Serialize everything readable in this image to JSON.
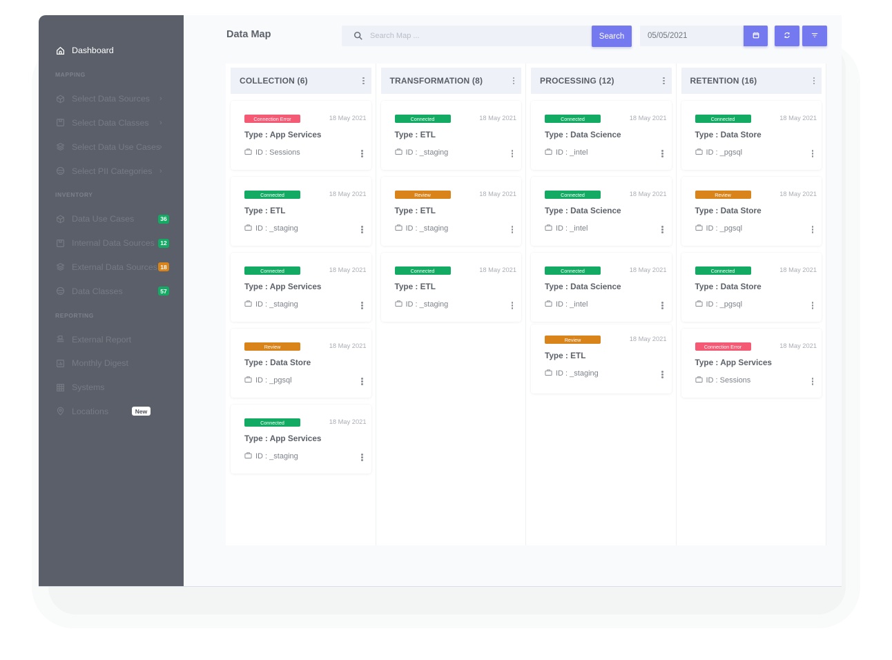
{
  "sidebar": {
    "dashboard": {
      "label": "Dashboard",
      "icon": "home-icon"
    },
    "sections": [
      {
        "title": "MAPPING",
        "items": [
          {
            "label": "Select Data Sources",
            "icon": "cube-icon",
            "chevron": "›"
          },
          {
            "label": "Select Data Classes",
            "icon": "box-icon",
            "chevron": "›"
          },
          {
            "label": "Select Data Use Cases",
            "icon": "layers-icon",
            "chevron": "›"
          },
          {
            "label": "Select PII Categories",
            "icon": "mask-icon",
            "chevron": "›"
          }
        ]
      },
      {
        "title": "INVENTORY",
        "items": [
          {
            "label": "Data Use Cases",
            "icon": "cube-icon",
            "badge": "36",
            "badge_color": "#13ab63"
          },
          {
            "label": "Internal Data Sources",
            "icon": "box-icon",
            "badge": "12",
            "badge_color": "#13ab63"
          },
          {
            "label": "External Data Sources",
            "icon": "layers-icon",
            "badge": "18",
            "badge_color": "#d9841b"
          },
          {
            "label": "Data Classes",
            "icon": "mask-icon",
            "badge": "57",
            "badge_color": "#13ab63"
          }
        ]
      },
      {
        "title": "REPORTING",
        "items": [
          {
            "label": "External Report",
            "icon": "report-icon"
          },
          {
            "label": "Monthly Digest",
            "icon": "chart-icon"
          },
          {
            "label": "Systems",
            "icon": "grid-icon"
          },
          {
            "label": "Locations",
            "icon": "location-pin-icon",
            "tag": "New"
          }
        ]
      }
    ]
  },
  "header": {
    "title": "Data Map",
    "search_placeholder": "Search Map ...",
    "search_button": "Search",
    "date_value": "05/05/2021"
  },
  "colors": {
    "accent": "#7579ef",
    "sidebar_bg": "#5a5f69",
    "connected": "#13ab63",
    "error": "#f45a74",
    "review": "#d9841b"
  },
  "columns": [
    {
      "title": "COLLECTION (6)",
      "cards": [
        {
          "status": "Connection Error",
          "kind": "err",
          "date": "18 May 2021",
          "type": "Type : App Services",
          "id": "ID : Sessions"
        },
        {
          "status": "Connected",
          "kind": "ok",
          "date": "18 May 2021",
          "type": "Type : ETL",
          "id": "ID : _staging"
        },
        {
          "status": "Connected",
          "kind": "ok",
          "date": "18 May 2021",
          "type": "Type : App Services",
          "id": "ID : _staging"
        },
        {
          "status": "Review",
          "kind": "rev",
          "date": "18 May 2021",
          "type": "Type : Data Store",
          "id": "ID : _pgsql"
        },
        {
          "status": "Connected",
          "kind": "ok",
          "date": "18 May 2021",
          "type": "Type : App Services",
          "id": "ID : _staging"
        }
      ]
    },
    {
      "title": "TRANSFORMATION (8)",
      "cards": [
        {
          "status": "Connected",
          "kind": "ok",
          "date": "18 May 2021",
          "type": "Type : ETL",
          "id": "ID : _staging"
        },
        {
          "status": "Review",
          "kind": "rev",
          "date": "18 May 2021",
          "type": "Type : ETL",
          "id": "ID : _staging"
        },
        {
          "status": "Connected",
          "kind": "ok",
          "date": "18 May 2021",
          "type": "Type : ETL",
          "id": "ID : _staging"
        }
      ]
    },
    {
      "title": "PROCESSING (12)",
      "cards": [
        {
          "status": "Connected",
          "kind": "ok",
          "date": "18 May 2021",
          "type": "Type : Data Science",
          "id": "ID : _intel"
        },
        {
          "status": "Connected",
          "kind": "ok",
          "date": "18 May 2021",
          "type": "Type : Data Science",
          "id": "ID : _intel"
        },
        {
          "status": "Connected",
          "kind": "ok",
          "date": "18 May 2021",
          "type": "Type : Data Science",
          "id": "ID : _intel"
        },
        {
          "status": "Review",
          "kind": "rev",
          "date": "18 May 2021",
          "type": "Type : ETL",
          "id": "ID : _staging"
        }
      ]
    },
    {
      "title": "RETENTION (16)",
      "cards": [
        {
          "status": "Connected",
          "kind": "ok",
          "date": "18 May 2021",
          "type": "Type : Data Store",
          "id": "ID : _pgsql"
        },
        {
          "status": "Review",
          "kind": "rev",
          "date": "18 May 2021",
          "type": "Type : Data Store",
          "id": "ID : _pgsql"
        },
        {
          "status": "Connected",
          "kind": "ok",
          "date": "18 May 2021",
          "type": "Type : Data Store",
          "id": "ID : _pgsql"
        },
        {
          "status": "Connection Error",
          "kind": "err",
          "date": "18 May 2021",
          "type": "Type : App Services",
          "id": "ID : Sessions"
        }
      ]
    }
  ]
}
